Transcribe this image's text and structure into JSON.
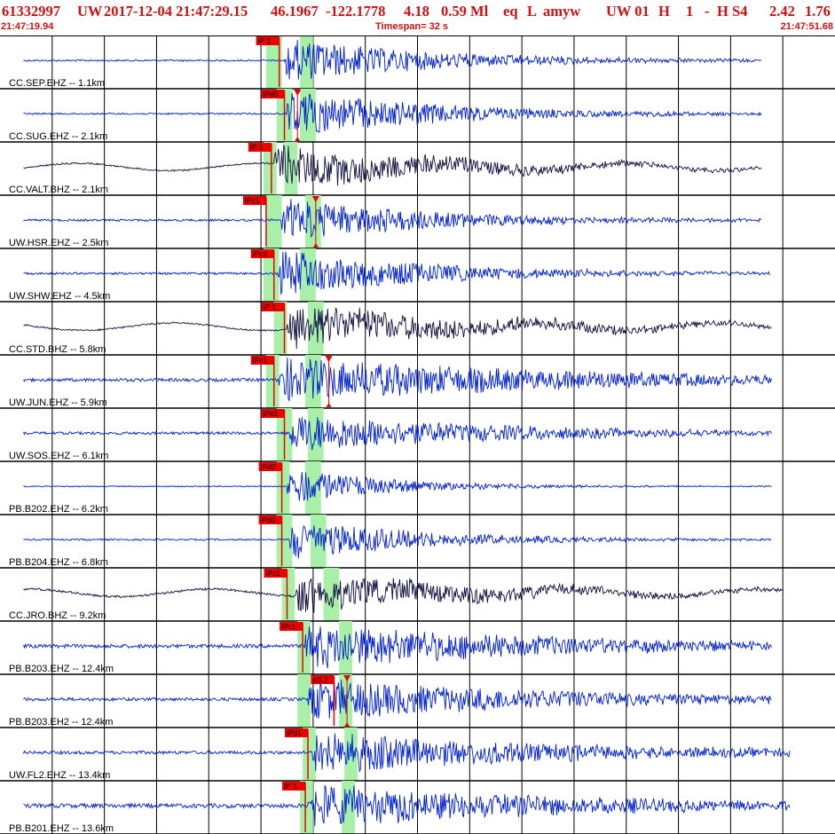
{
  "header": {
    "title": {
      "event_id": "61332997",
      "network": "UW",
      "datetime": "2017-12-04 21:47:29.15",
      "lat": "46.1967",
      "lon": "-122.1778",
      "depth": "4.18",
      "magnitude": "0.59 Ml",
      "type": "eq",
      "flag": "L",
      "author": "amyw",
      "net_code": "UW 01",
      "h1": "H",
      "h2": "1",
      "h3": "-",
      "h4": "H S4",
      "v1": "2.42",
      "v2": "1.76"
    },
    "start_time": "21:47:19.94",
    "timespan": "Timespan=  32 s",
    "end_time": "21:47:51.68"
  },
  "colors": {
    "header_text": "#d11010",
    "pick": "#ee0000",
    "window": "#a8f0a8",
    "trace_blue": "#0020d0",
    "trace_black": "#101040",
    "grid": "#000000"
  },
  "channels": [
    {
      "label": "CC.SEP.EHZ -- 1.1km",
      "pick": "iP 1",
      "pick_s": 10.7,
      "color": "blue",
      "amp": 0.42,
      "noise": 0.03,
      "onset": 10.9,
      "decay": 6,
      "end": 29.2,
      "win": [
        10.2,
        10.8,
        11.5,
        12.0
      ],
      "red2": null
    },
    {
      "label": "CC.SUG.EHZ -- 2.1km",
      "pick": "iPd0",
      "pick_s": 10.9,
      "color": "blue",
      "amp": 0.45,
      "noise": 0.03,
      "onset": 11.0,
      "decay": 6,
      "end": 29.2,
      "win": [
        10.6,
        11.2,
        11.5,
        12.1
      ],
      "red2": 11.4
    },
    {
      "label": "CC.VALT.BHZ -- 2.1km",
      "pick": "iP 1",
      "pick_s": 10.4,
      "color": "black",
      "amp": 0.4,
      "noise": 0.03,
      "onset": 10.5,
      "decay": 7,
      "end": 29.2,
      "win": [
        10.1,
        10.6,
        10.9,
        11.4
      ],
      "red2": null
    },
    {
      "label": "UW.HSR.EHZ -- 2.5km",
      "pick": "iPc1",
      "pick_s": 10.2,
      "color": "blue",
      "amp": 0.42,
      "noise": 0.04,
      "onset": 10.8,
      "decay": 6,
      "end": 29.2,
      "win": [
        10.2,
        10.8,
        11.7,
        12.3
      ],
      "red2": 12.1
    },
    {
      "label": "UW.SHW.EHZ -- 4.5km",
      "pick": "iPc1",
      "pick_s": 10.5,
      "color": "blue",
      "amp": 0.45,
      "noise": 0.04,
      "onset": 10.6,
      "decay": 6,
      "end": 29.5,
      "win": [
        10.1,
        10.7,
        11.5,
        12.1
      ],
      "red2": null
    },
    {
      "label": "CC.STD.BHZ -- 5.8km",
      "pick": "iP 1",
      "pick_s": 10.9,
      "color": "black",
      "amp": 0.4,
      "noise": 0.03,
      "onset": 11.0,
      "decay": 8,
      "end": 29.6,
      "win": [
        10.5,
        11.0,
        11.8,
        12.4
      ],
      "red2": null
    },
    {
      "label": "UW.JUN.EHZ -- 5.9km",
      "pick": "iPc1",
      "pick_s": 10.5,
      "color": "blue",
      "amp": 0.42,
      "noise": 0.06,
      "onset": 10.7,
      "decay": 12,
      "end": 29.6,
      "win": [
        10.2,
        10.7,
        11.7,
        12.3
      ],
      "red2": 12.6
    },
    {
      "label": "UW.SOS.EHZ -- 6.1km",
      "pick": "iPd1",
      "pick_s": 10.9,
      "color": "blue",
      "amp": 0.38,
      "noise": 0.05,
      "onset": 11.1,
      "decay": 8,
      "end": 29.6,
      "win": [
        10.6,
        11.2,
        11.8,
        12.4
      ],
      "red2": null
    },
    {
      "label": "PB.B202.EHZ -- 6.2km",
      "pick": "iPd0",
      "pick_s": 10.8,
      "color": "blue",
      "amp": 0.35,
      "noise": 0.02,
      "onset": 11.0,
      "decay": 4,
      "end": 29.6,
      "win": [
        10.6,
        11.1,
        11.7,
        12.3
      ],
      "red2": null
    },
    {
      "label": "PB.B204.EHZ -- 6.8km",
      "pick": "iPd0",
      "pick_s": 10.8,
      "color": "blue",
      "amp": 0.4,
      "noise": 0.03,
      "onset": 11.1,
      "decay": 5,
      "end": 29.6,
      "win": [
        10.6,
        11.2,
        11.9,
        12.5
      ],
      "red2": null
    },
    {
      "label": "CC.JRO.BHZ -- 9.2km",
      "pick": "iPc1",
      "pick_s": 11.0,
      "color": "black",
      "amp": 0.36,
      "noise": 0.04,
      "onset": 11.3,
      "decay": 8,
      "end": 30.0,
      "win": [
        10.8,
        11.3,
        12.4,
        13.0
      ],
      "red2": null
    },
    {
      "label": "PB.B203.EHZ -- 12.4km",
      "pick": "iPc1",
      "pick_s": 11.6,
      "color": "blue",
      "amp": 0.42,
      "noise": 0.07,
      "onset": 11.7,
      "decay": 10,
      "end": 29.6,
      "win": [
        11.4,
        11.9,
        13.0,
        13.5
      ],
      "red2": null
    },
    {
      "label": "PB.B203.EH2 -- 12.4km",
      "pick": "eS 2",
      "pick_s": 12.8,
      "color": "blue",
      "amp": 0.4,
      "noise": 0.06,
      "onset": 11.8,
      "decay": 10,
      "end": 29.6,
      "win": [
        11.4,
        11.9,
        13.0,
        13.5
      ],
      "red2": 13.3
    },
    {
      "label": "UW.FL2.EHZ -- 13.4km",
      "pick": "iPd1",
      "pick_s": 11.8,
      "color": "blue",
      "amp": 0.4,
      "noise": 0.06,
      "onset": 11.9,
      "decay": 10,
      "end": 30.3,
      "win": [
        11.6,
        12.1,
        13.2,
        13.7
      ],
      "red2": null
    },
    {
      "label": "PB.B201.EHZ -- 13.6km",
      "pick": "iP 1",
      "pick_s": 11.7,
      "color": "blue",
      "amp": 0.42,
      "noise": 0.08,
      "onset": 11.8,
      "decay": 10,
      "end": 30.3,
      "win": [
        11.5,
        12.0,
        13.1,
        13.6
      ],
      "red2": null
    }
  ]
}
